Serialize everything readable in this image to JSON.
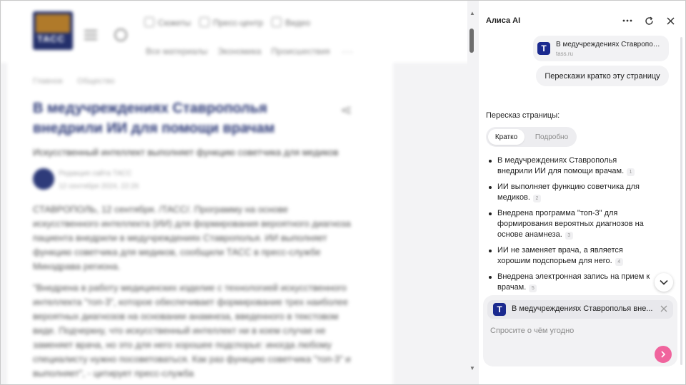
{
  "page": {
    "header": {
      "logo_text": "ТАСС",
      "nav_top": [
        "Сюжеты",
        "Пресс-центр",
        "Видео"
      ],
      "nav_sections": [
        "Все материалы",
        "Экономика",
        "Происшествия"
      ],
      "more": "···"
    },
    "article": {
      "breadcrumbs": [
        "Главное",
        "Общество"
      ],
      "title": "В медучреждениях Ставрополья внедрили ИИ для помощи врачам",
      "lead": "Искусственный интеллект выполняет функцию советчика для медиков",
      "author": "Редакция сайта ТАСС",
      "date": "12 сентября 2024, 22:26",
      "paragraphs": [
        "СТАВРОПОЛЬ, 12 сентября. /ТАСС/. Программу на основе искусственного интеллекта (ИИ) для формирования вероятного диагноза пациента внедрили в медучреждениях Ставрополья. ИИ выполняет функцию советчика для медиков, сообщили ТАСС в пресс-службе Минздрава региона.",
        "\"Внедрена в работу медицинских изделие с технологией искусственного интеллекта \"топ-3\", которое обеспечивает формирование трех наиболее вероятных диагнозов на основании анамнеза, введенного в текстовом виде. Подчеркну, что искусственный интеллект ни в коем случае не заменяет врача, но это для него хорошее подспорье: иногда любому специалисту нужно посоветоваться. Как раз функцию советчика \"топ-3\" и выполняет\", - цитирует пресс-служба"
      ]
    }
  },
  "panel": {
    "title": "Алиса AI",
    "header_icons": [
      "more-dots-icon",
      "refresh-icon",
      "close-icon"
    ],
    "source": {
      "icon_letter": "Т",
      "title": "В медучреждениях Ставрополья внедрили ИИ для помощи врачам",
      "domain": "tass.ru"
    },
    "user_message": "Перескажи кратко эту страницу",
    "summary_heading": "Пересказ страницы:",
    "tabs": {
      "active": "Кратко",
      "other": "Подробно"
    },
    "bullets": [
      {
        "text": "В медучреждениях Ставрополья внедрили ИИ для помощи врачам.",
        "ref": "1"
      },
      {
        "text": "ИИ выполняет функцию советчика для медиков.",
        "ref": "2"
      },
      {
        "text": "Внедрена программа \"топ-3\" для формирования вероятных диагнозов на основе анамнеза.",
        "ref": "3"
      },
      {
        "text": "ИИ не заменяет врача, а является хорошим подспорьем для него.",
        "ref": "4"
      },
      {
        "text": "Внедрена электронная запись на прием к врачам.",
        "ref": "5"
      }
    ],
    "composer": {
      "context_icon_letter": "Т",
      "context_title": "В медучреждениях Ставрополья вне...",
      "placeholder": "Спросите о чём угодно"
    },
    "colors": {
      "send_accent": "#f0649d",
      "source_icon": "#1b2a8f"
    }
  }
}
